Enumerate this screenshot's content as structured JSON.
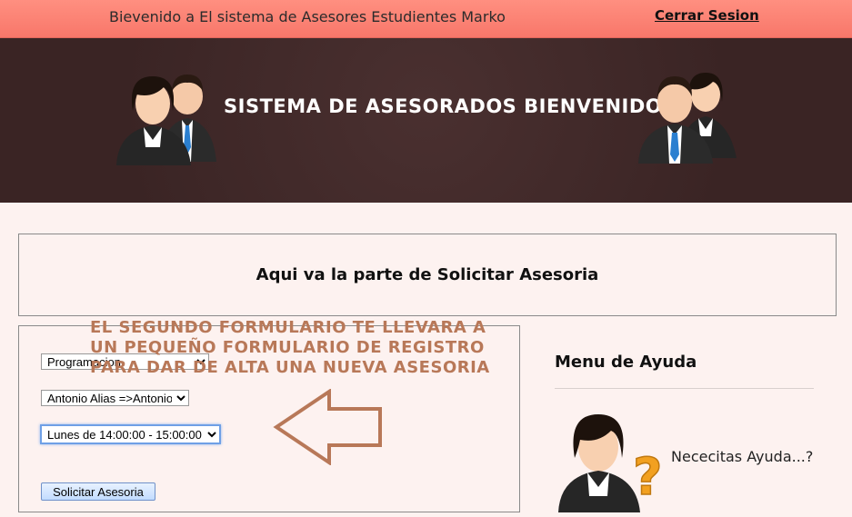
{
  "topbar": {
    "welcome": "Bievenido a El sistema de Asesores Estudientes Marko",
    "logout": "Cerrar Sesion"
  },
  "header": {
    "title": "SISTEMA DE ASESORADOS BIENVENIDO"
  },
  "section": {
    "title": "Aqui va la parte de Solicitar Asesoria"
  },
  "form": {
    "materia_selected": "Programacion",
    "asesor_selected": "Antonio Alias =>Antonio",
    "horario_selected": "Lunes de 14:00:00 - 15:00:00",
    "submit_label": "Solicitar Asesoria"
  },
  "annotation": {
    "text": "EL SEGUNDO FORMULARIO TE LLEVARA A UN PEQUEÑO FORMULARIO DE REGISTRO PARA DAR DE ALTA UNA NUEVA ASESORIA"
  },
  "help": {
    "title": "Menu de Ayuda",
    "text": "Nececitas Ayuda...?"
  },
  "colors": {
    "topbar": "#f8776a",
    "header_bg": "#3c2626",
    "page_bg": "#fdf2f0",
    "annotation": "#b87858",
    "question_mark": "#f2a020"
  },
  "icons": {
    "header_left": "business-people-icon",
    "header_right": "business-people-icon",
    "help": "help-person-icon"
  }
}
